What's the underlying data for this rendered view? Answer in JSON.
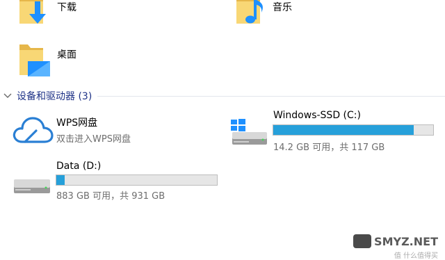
{
  "folders": [
    {
      "label": "下载",
      "icon": "downloads-folder-icon"
    },
    {
      "label": "音乐",
      "icon": "music-folder-icon"
    },
    {
      "label": "桌面",
      "icon": "desktop-folder-icon"
    }
  ],
  "devices_section": {
    "title": "设备和驱动器 (3)"
  },
  "drives": [
    {
      "name": "WPS网盘",
      "subtitle": "双击进入WPS网盘",
      "icon": "cloud-icon"
    },
    {
      "name": "Windows-SSD (C:)",
      "space_text": "14.2 GB 可用，共 117 GB",
      "used_fraction": 0.879,
      "icon": "windows-drive-icon"
    },
    {
      "name": "Data (D:)",
      "space_text": "883 GB 可用，共 931 GB",
      "used_fraction": 0.052,
      "icon": "drive-icon"
    }
  ],
  "watermark": {
    "text": "SMYZ.NET",
    "subtext": "值 什么值得买"
  },
  "colors": {
    "progress_fill": "#26a0da",
    "section_title": "#1e3287",
    "folder_yellow": "#f8d775",
    "accent_blue": "#1e90ff"
  }
}
